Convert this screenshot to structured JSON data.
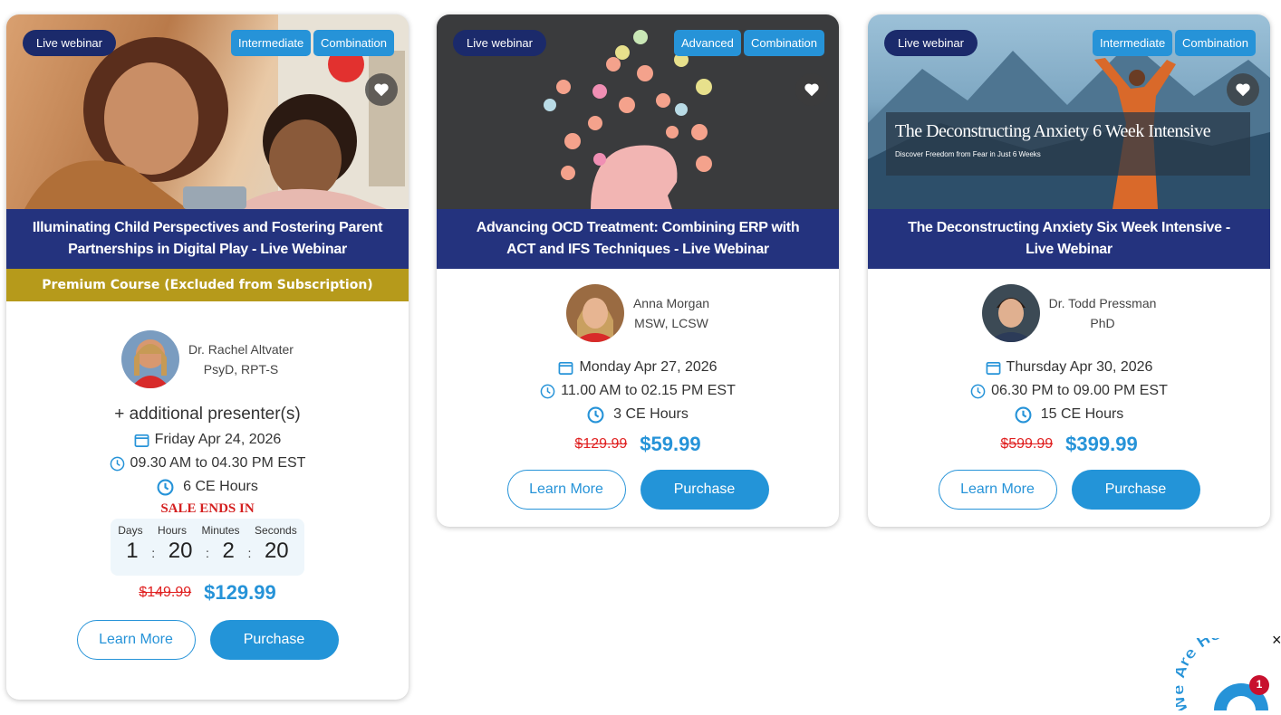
{
  "cards": [
    {
      "format": "Live webinar",
      "level": "Intermediate",
      "type": "Combination",
      "title": "Illuminating Child Perspectives and Fostering Parent Partnerships in Digital Play - Live Webinar",
      "premium": "Premium Course (Excluded from Subscription)",
      "presenter_name": "Dr. Rachel Altvater",
      "presenter_creds": "PsyD, RPT-S",
      "additional": "+ additional presenter(s)",
      "date": "Friday Apr 24, 2026",
      "time": "09.30 AM to 04.30 PM EST",
      "ce": "6 CE Hours",
      "sale_label": "SALE ENDS IN",
      "countdown": {
        "days_label": "Days",
        "hours_label": "Hours",
        "minutes_label": "Minutes",
        "seconds_label": "Seconds",
        "days": "1",
        "hours": "20",
        "minutes": "2",
        "seconds": "20"
      },
      "old_price": "$149.99",
      "new_price": "$129.99",
      "learn_more": "Learn More",
      "purchase": "Purchase"
    },
    {
      "format": "Live webinar",
      "level": "Advanced",
      "type": "Combination",
      "title": "Advancing OCD Treatment: Combining ERP with ACT and IFS Techniques - Live Webinar",
      "presenter_name": "Anna Morgan",
      "presenter_creds": "MSW, LCSW",
      "date": "Monday Apr 27, 2026",
      "time": "11.00 AM to 02.15 PM EST",
      "ce": "3 CE Hours",
      "old_price": "$129.99",
      "new_price": "$59.99",
      "learn_more": "Learn More",
      "purchase": "Purchase"
    },
    {
      "format": "Live webinar",
      "level": "Intermediate",
      "type": "Combination",
      "hero_title": "The Deconstructing Anxiety 6 Week Intensive",
      "hero_subtitle": "Discover Freedom from Fear in Just 6 Weeks",
      "title": "The Deconstructing Anxiety Six Week Intensive - Live Webinar",
      "presenter_name": "Dr. Todd Pressman",
      "presenter_creds": "PhD",
      "date": "Thursday Apr 30, 2026",
      "time": "06.30 PM to 09.00 PM EST",
      "ce": "15 CE Hours",
      "old_price": "$599.99",
      "new_price": "$399.99",
      "learn_more": "Learn More",
      "purchase": "Purchase"
    }
  ],
  "chat_widget": {
    "text": "We Are Here!",
    "badge": "1",
    "close": "×"
  },
  "colors": {
    "accent": "#2693d8",
    "navy": "#24337e",
    "premium": "#b69a1b",
    "sale": "#d42020"
  }
}
